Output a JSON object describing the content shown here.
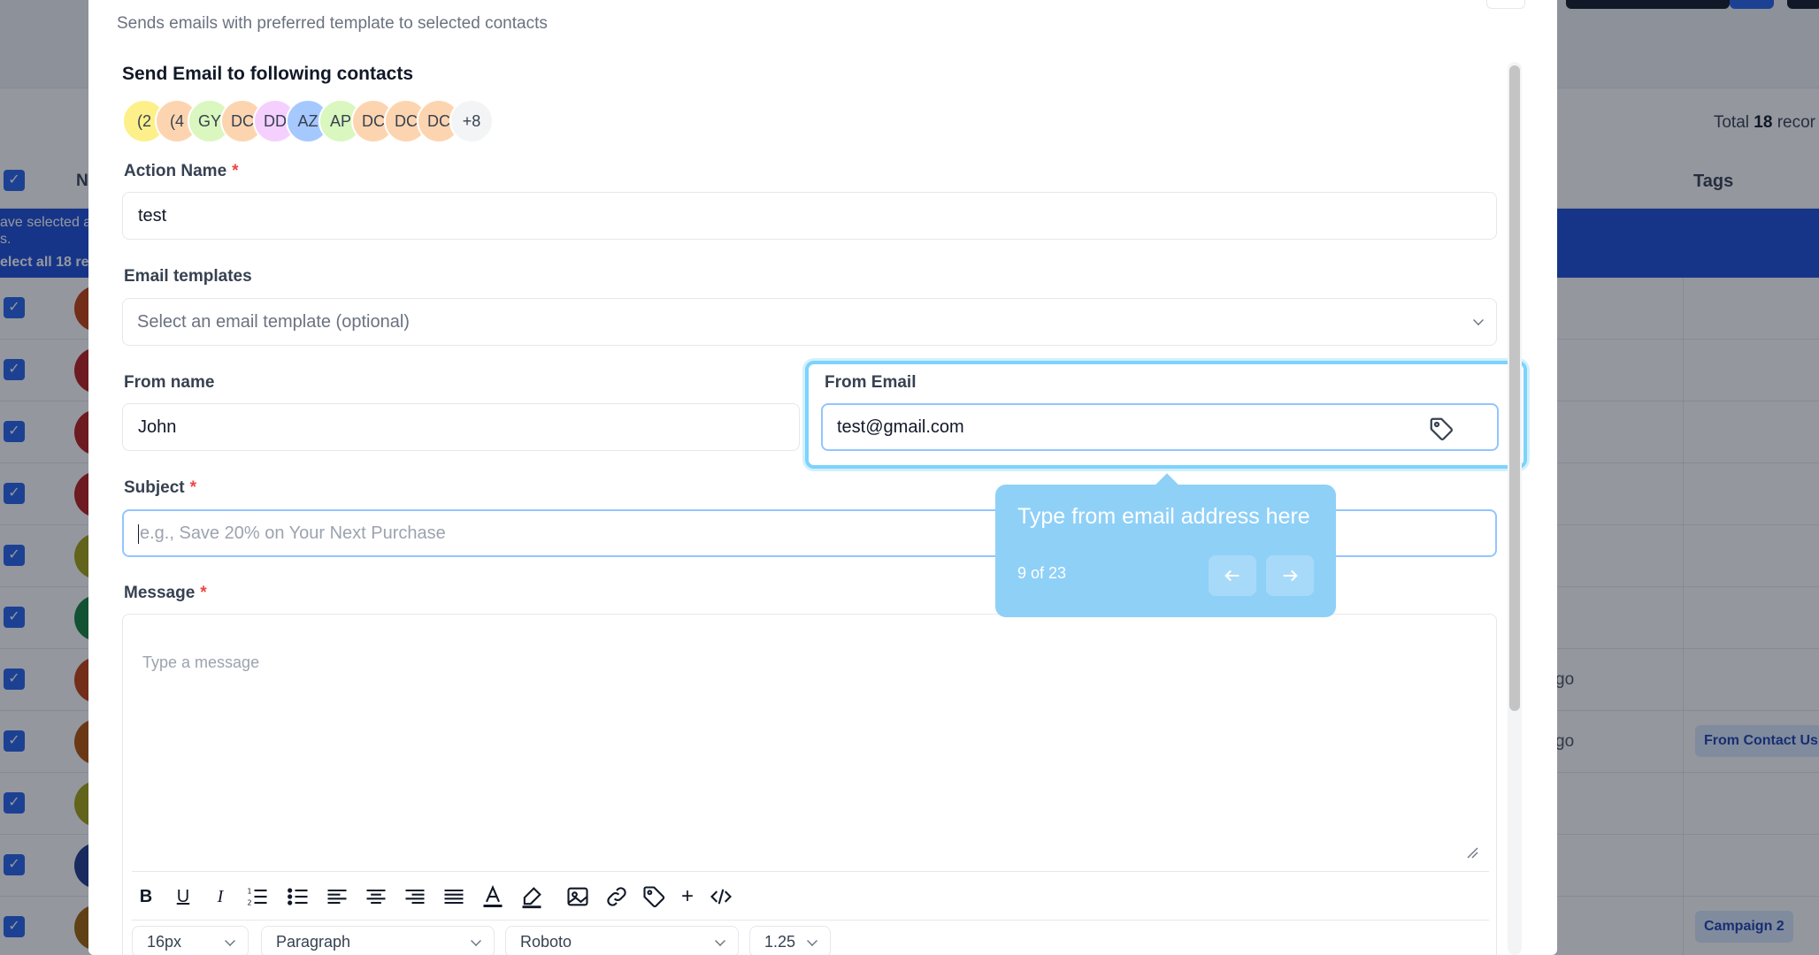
{
  "background": {
    "total_prefix": "Total",
    "total_count": "18",
    "total_suffix": "recor",
    "col_name": "N",
    "col_tags": "Tags",
    "banner_line1": "ave selected a",
    "banner_line1b": "s.",
    "banner_line2": "elect all 18 rec",
    "ago_text": "go",
    "tags": {
      "row8": "From Contact Us",
      "row11": "Campaign 2"
    }
  },
  "modal": {
    "subtitle": "Sends emails with preferred template to selected contacts",
    "section_title": "Send Email to following contacts",
    "recipients": [
      "(2",
      "(4",
      "GY",
      "DC",
      "DD",
      "AZ",
      "AP",
      "DC",
      "DC",
      "DC",
      "+8"
    ],
    "recipient_colors": [
      "#fdf08a",
      "#fcd5b0",
      "#d9f7be",
      "#fcd5b0",
      "#f5d0fe",
      "#a5c8ff",
      "#d9f7be",
      "#fcd5b0",
      "#fcd5b0",
      "#fcd5b0",
      "#f3f4f6"
    ],
    "action_name": {
      "label": "Action Name",
      "required_mark": "*",
      "value": "test"
    },
    "email_templates": {
      "label": "Email templates",
      "placeholder": "Select an email template (optional)"
    },
    "from_name": {
      "label": "From name",
      "value": "John"
    },
    "from_email": {
      "label": "From Email",
      "value": "test@gmail.com"
    },
    "subject": {
      "label": "Subject",
      "required_mark": "*",
      "placeholder": "e.g., Save 20% on Your Next Purchase"
    },
    "message": {
      "label": "Message",
      "required_mark": "*",
      "placeholder": "Type a message"
    },
    "toolbar": {
      "font_size": "16px",
      "block_type": "Paragraph",
      "font_family": "Roboto",
      "line_height": "1.25"
    }
  },
  "tooltip": {
    "text": "Type from email address here",
    "counter": "9 of 23"
  },
  "colors": {
    "primary": "#2563eb",
    "tooltip_bg": "#8fd0f7",
    "required": "#ef4444"
  }
}
